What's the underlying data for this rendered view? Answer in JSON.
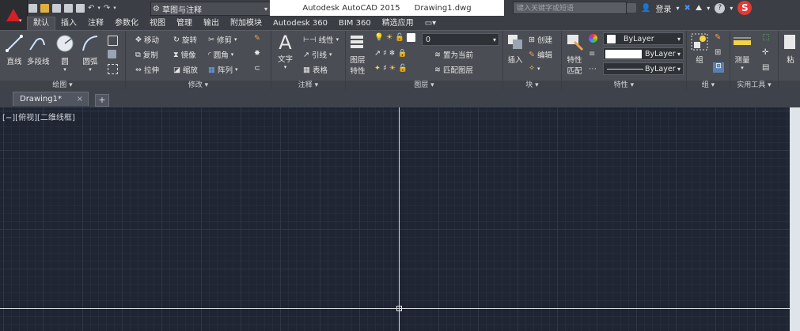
{
  "app": {
    "menu_button_icon": "autocad-a-logo",
    "workspace": "草图与注释",
    "title_app": "Autodesk AutoCAD 2015",
    "title_file": "Drawing1.dwg",
    "search_placeholder": "键入关键字或短语",
    "login": "登录",
    "help": "?",
    "logo_letter": "S"
  },
  "tabs": [
    "默认",
    "插入",
    "注释",
    "参数化",
    "视图",
    "管理",
    "输出",
    "附加模块",
    "Autodesk 360",
    "BIM 360",
    "精选应用"
  ],
  "ribbon": {
    "draw": {
      "title": "绘图 ▾",
      "line": "直线",
      "polyline": "多段线",
      "circle": "圆",
      "arc": "圆弧"
    },
    "modify": {
      "title": "修改 ▾",
      "move": "移动",
      "rotate": "旋转",
      "trim": "修剪",
      "copy": "复制",
      "mirror": "镜像",
      "fillet": "圆角",
      "stretch": "拉伸",
      "scale": "缩放",
      "array": "阵列"
    },
    "annotation": {
      "title": "注释 ▾",
      "text": "文字",
      "linear": "线性",
      "leader": "引线",
      "table": "表格"
    },
    "layers": {
      "title": "图层 ▾",
      "layer_props_1": "图层",
      "layer_props_2": "特性",
      "current_layer": "0",
      "set_current": "置为当前",
      "match_layer": "匹配图层"
    },
    "block": {
      "title": "块 ▾",
      "insert": "插入",
      "create": "创建",
      "edit": "编辑"
    },
    "properties": {
      "title": "特性 ▾",
      "match_1": "特性",
      "match_2": "匹配",
      "color": "ByLayer",
      "linetype": "ByLayer",
      "lineweight": "ByLayer"
    },
    "groups": {
      "title": "组 ▾",
      "group": "组"
    },
    "utilities": {
      "title": "实用工具 ▾",
      "measure": "测量"
    },
    "clipboard": {
      "paste": "粘"
    }
  },
  "doc": {
    "tab_label": "Drawing1*",
    "close": "×",
    "new_tab": "+",
    "viewport_label": "[−][俯视][二维线框]"
  }
}
